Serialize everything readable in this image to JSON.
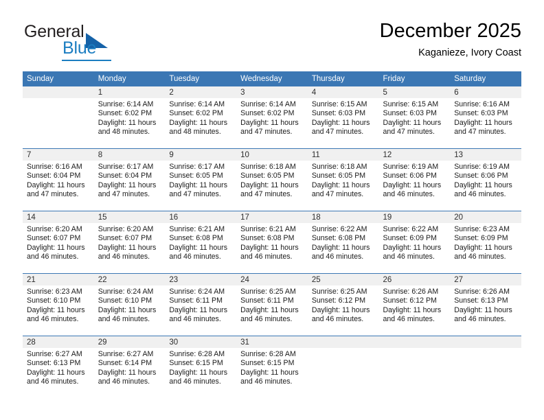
{
  "brand": {
    "name_part1": "General",
    "name_part2": "Blue",
    "logo_icon": "triangle-logo-icon"
  },
  "header": {
    "title": "December 2025",
    "subtitle": "Kaganieze, Ivory Coast"
  },
  "calendar": {
    "weekday_headers": [
      "Sunday",
      "Monday",
      "Tuesday",
      "Wednesday",
      "Thursday",
      "Friday",
      "Saturday"
    ],
    "accent_color": "#3b77b4",
    "daynum_band_color": "#f0f0f0",
    "weeks": [
      [
        {
          "day": "",
          "sunrise": "",
          "sunset": "",
          "daylight_line1": "",
          "daylight_line2": ""
        },
        {
          "day": "1",
          "sunrise": "Sunrise: 6:14 AM",
          "sunset": "Sunset: 6:02 PM",
          "daylight_line1": "Daylight: 11 hours",
          "daylight_line2": "and 48 minutes."
        },
        {
          "day": "2",
          "sunrise": "Sunrise: 6:14 AM",
          "sunset": "Sunset: 6:02 PM",
          "daylight_line1": "Daylight: 11 hours",
          "daylight_line2": "and 48 minutes."
        },
        {
          "day": "3",
          "sunrise": "Sunrise: 6:14 AM",
          "sunset": "Sunset: 6:02 PM",
          "daylight_line1": "Daylight: 11 hours",
          "daylight_line2": "and 47 minutes."
        },
        {
          "day": "4",
          "sunrise": "Sunrise: 6:15 AM",
          "sunset": "Sunset: 6:03 PM",
          "daylight_line1": "Daylight: 11 hours",
          "daylight_line2": "and 47 minutes."
        },
        {
          "day": "5",
          "sunrise": "Sunrise: 6:15 AM",
          "sunset": "Sunset: 6:03 PM",
          "daylight_line1": "Daylight: 11 hours",
          "daylight_line2": "and 47 minutes."
        },
        {
          "day": "6",
          "sunrise": "Sunrise: 6:16 AM",
          "sunset": "Sunset: 6:03 PM",
          "daylight_line1": "Daylight: 11 hours",
          "daylight_line2": "and 47 minutes."
        }
      ],
      [
        {
          "day": "7",
          "sunrise": "Sunrise: 6:16 AM",
          "sunset": "Sunset: 6:04 PM",
          "daylight_line1": "Daylight: 11 hours",
          "daylight_line2": "and 47 minutes."
        },
        {
          "day": "8",
          "sunrise": "Sunrise: 6:17 AM",
          "sunset": "Sunset: 6:04 PM",
          "daylight_line1": "Daylight: 11 hours",
          "daylight_line2": "and 47 minutes."
        },
        {
          "day": "9",
          "sunrise": "Sunrise: 6:17 AM",
          "sunset": "Sunset: 6:05 PM",
          "daylight_line1": "Daylight: 11 hours",
          "daylight_line2": "and 47 minutes."
        },
        {
          "day": "10",
          "sunrise": "Sunrise: 6:18 AM",
          "sunset": "Sunset: 6:05 PM",
          "daylight_line1": "Daylight: 11 hours",
          "daylight_line2": "and 47 minutes."
        },
        {
          "day": "11",
          "sunrise": "Sunrise: 6:18 AM",
          "sunset": "Sunset: 6:05 PM",
          "daylight_line1": "Daylight: 11 hours",
          "daylight_line2": "and 47 minutes."
        },
        {
          "day": "12",
          "sunrise": "Sunrise: 6:19 AM",
          "sunset": "Sunset: 6:06 PM",
          "daylight_line1": "Daylight: 11 hours",
          "daylight_line2": "and 46 minutes."
        },
        {
          "day": "13",
          "sunrise": "Sunrise: 6:19 AM",
          "sunset": "Sunset: 6:06 PM",
          "daylight_line1": "Daylight: 11 hours",
          "daylight_line2": "and 46 minutes."
        }
      ],
      [
        {
          "day": "14",
          "sunrise": "Sunrise: 6:20 AM",
          "sunset": "Sunset: 6:07 PM",
          "daylight_line1": "Daylight: 11 hours",
          "daylight_line2": "and 46 minutes."
        },
        {
          "day": "15",
          "sunrise": "Sunrise: 6:20 AM",
          "sunset": "Sunset: 6:07 PM",
          "daylight_line1": "Daylight: 11 hours",
          "daylight_line2": "and 46 minutes."
        },
        {
          "day": "16",
          "sunrise": "Sunrise: 6:21 AM",
          "sunset": "Sunset: 6:08 PM",
          "daylight_line1": "Daylight: 11 hours",
          "daylight_line2": "and 46 minutes."
        },
        {
          "day": "17",
          "sunrise": "Sunrise: 6:21 AM",
          "sunset": "Sunset: 6:08 PM",
          "daylight_line1": "Daylight: 11 hours",
          "daylight_line2": "and 46 minutes."
        },
        {
          "day": "18",
          "sunrise": "Sunrise: 6:22 AM",
          "sunset": "Sunset: 6:08 PM",
          "daylight_line1": "Daylight: 11 hours",
          "daylight_line2": "and 46 minutes."
        },
        {
          "day": "19",
          "sunrise": "Sunrise: 6:22 AM",
          "sunset": "Sunset: 6:09 PM",
          "daylight_line1": "Daylight: 11 hours",
          "daylight_line2": "and 46 minutes."
        },
        {
          "day": "20",
          "sunrise": "Sunrise: 6:23 AM",
          "sunset": "Sunset: 6:09 PM",
          "daylight_line1": "Daylight: 11 hours",
          "daylight_line2": "and 46 minutes."
        }
      ],
      [
        {
          "day": "21",
          "sunrise": "Sunrise: 6:23 AM",
          "sunset": "Sunset: 6:10 PM",
          "daylight_line1": "Daylight: 11 hours",
          "daylight_line2": "and 46 minutes."
        },
        {
          "day": "22",
          "sunrise": "Sunrise: 6:24 AM",
          "sunset": "Sunset: 6:10 PM",
          "daylight_line1": "Daylight: 11 hours",
          "daylight_line2": "and 46 minutes."
        },
        {
          "day": "23",
          "sunrise": "Sunrise: 6:24 AM",
          "sunset": "Sunset: 6:11 PM",
          "daylight_line1": "Daylight: 11 hours",
          "daylight_line2": "and 46 minutes."
        },
        {
          "day": "24",
          "sunrise": "Sunrise: 6:25 AM",
          "sunset": "Sunset: 6:11 PM",
          "daylight_line1": "Daylight: 11 hours",
          "daylight_line2": "and 46 minutes."
        },
        {
          "day": "25",
          "sunrise": "Sunrise: 6:25 AM",
          "sunset": "Sunset: 6:12 PM",
          "daylight_line1": "Daylight: 11 hours",
          "daylight_line2": "and 46 minutes."
        },
        {
          "day": "26",
          "sunrise": "Sunrise: 6:26 AM",
          "sunset": "Sunset: 6:12 PM",
          "daylight_line1": "Daylight: 11 hours",
          "daylight_line2": "and 46 minutes."
        },
        {
          "day": "27",
          "sunrise": "Sunrise: 6:26 AM",
          "sunset": "Sunset: 6:13 PM",
          "daylight_line1": "Daylight: 11 hours",
          "daylight_line2": "and 46 minutes."
        }
      ],
      [
        {
          "day": "28",
          "sunrise": "Sunrise: 6:27 AM",
          "sunset": "Sunset: 6:13 PM",
          "daylight_line1": "Daylight: 11 hours",
          "daylight_line2": "and 46 minutes."
        },
        {
          "day": "29",
          "sunrise": "Sunrise: 6:27 AM",
          "sunset": "Sunset: 6:14 PM",
          "daylight_line1": "Daylight: 11 hours",
          "daylight_line2": "and 46 minutes."
        },
        {
          "day": "30",
          "sunrise": "Sunrise: 6:28 AM",
          "sunset": "Sunset: 6:15 PM",
          "daylight_line1": "Daylight: 11 hours",
          "daylight_line2": "and 46 minutes."
        },
        {
          "day": "31",
          "sunrise": "Sunrise: 6:28 AM",
          "sunset": "Sunset: 6:15 PM",
          "daylight_line1": "Daylight: 11 hours",
          "daylight_line2": "and 46 minutes."
        },
        {
          "day": "",
          "sunrise": "",
          "sunset": "",
          "daylight_line1": "",
          "daylight_line2": ""
        },
        {
          "day": "",
          "sunrise": "",
          "sunset": "",
          "daylight_line1": "",
          "daylight_line2": ""
        },
        {
          "day": "",
          "sunrise": "",
          "sunset": "",
          "daylight_line1": "",
          "daylight_line2": ""
        }
      ]
    ]
  }
}
